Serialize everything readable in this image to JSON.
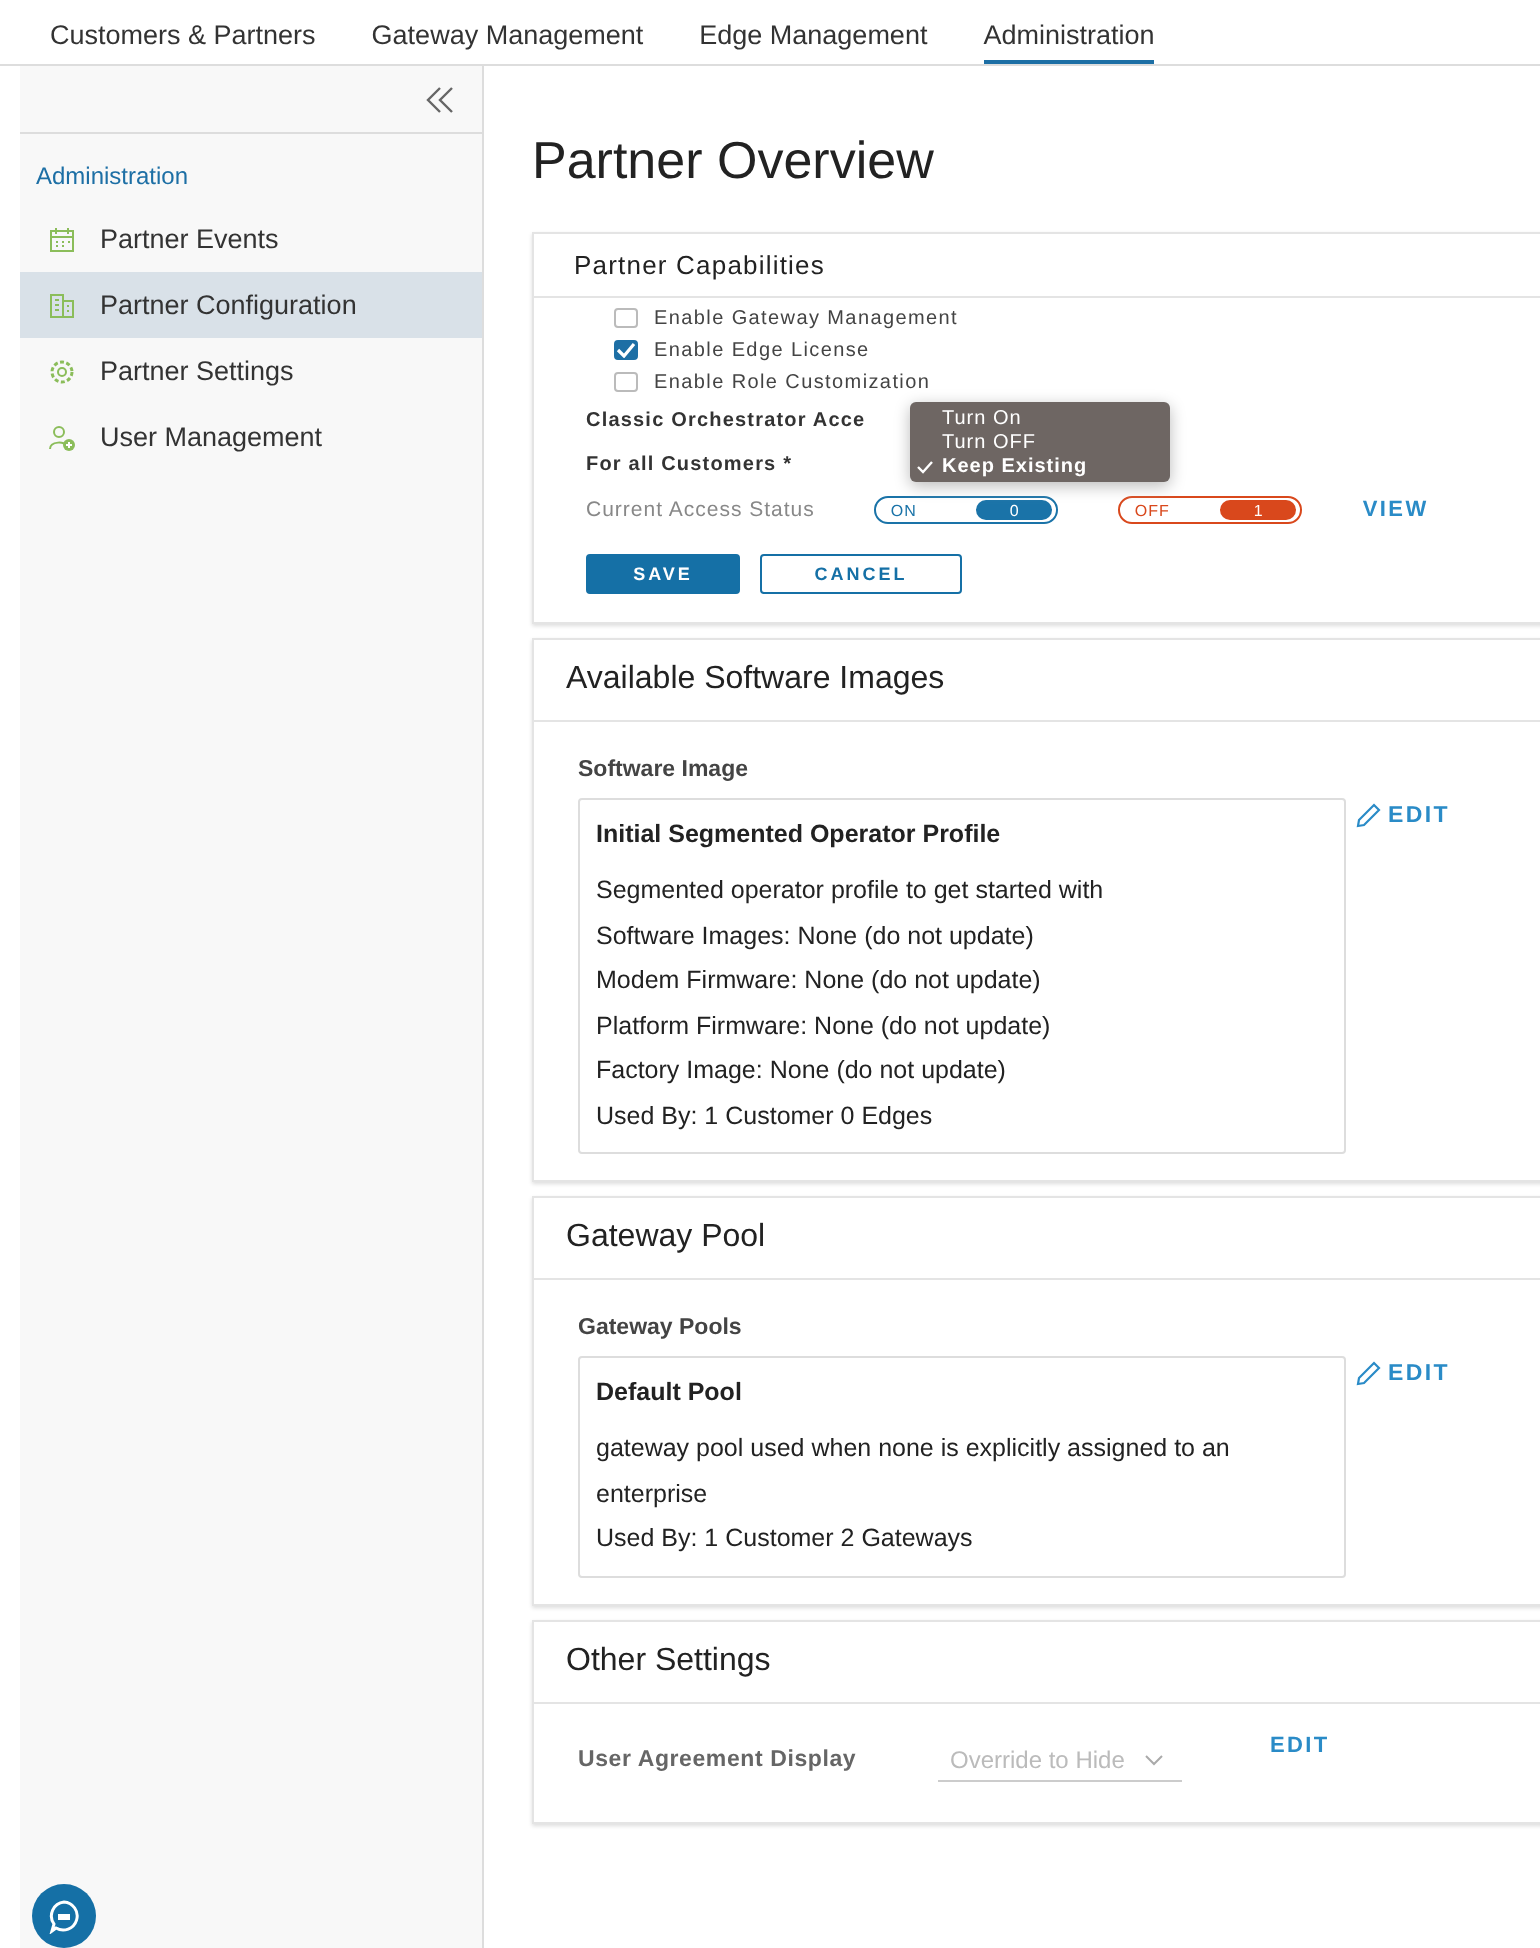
{
  "top_tabs": [
    {
      "label": "Customers & Partners",
      "selected": false
    },
    {
      "label": "Gateway Management",
      "selected": false
    },
    {
      "label": "Edge Management",
      "selected": false
    },
    {
      "label": "Administration",
      "selected": true
    }
  ],
  "sidebar": {
    "section": "Administration",
    "items": [
      {
        "label": "Partner Events",
        "selected": false
      },
      {
        "label": "Partner Configuration",
        "selected": true
      },
      {
        "label": "Partner Settings",
        "selected": false
      },
      {
        "label": "User Management",
        "selected": false
      }
    ]
  },
  "page_title": "Partner Overview",
  "capabilities": {
    "title": "Partner Capabilities",
    "options": [
      {
        "label": "Enable Gateway Management",
        "checked": false
      },
      {
        "label": "Enable Edge License",
        "checked": true
      },
      {
        "label": "Enable Role Customization",
        "checked": false
      }
    ],
    "classic_label": "Classic Orchestrator Acce",
    "customers_label": "For all Customers *",
    "menu": [
      {
        "label": "Turn On",
        "selected": false
      },
      {
        "label": "Turn OFF",
        "selected": false
      },
      {
        "label": "Keep Existing",
        "selected": true
      }
    ],
    "status_label": "Current Access Status",
    "status_pills": [
      {
        "label": "ON",
        "count": "0",
        "color": "#1a73a8"
      },
      {
        "label": "OFF",
        "count": "1",
        "color": "#d9481c"
      }
    ],
    "view": "VIEW",
    "buttons": [
      {
        "label": "SAVE",
        "kind": "primary"
      },
      {
        "label": "CANCEL",
        "kind": "secondary"
      }
    ]
  },
  "software_images": {
    "title": "Available Software Images",
    "label": "Software Image",
    "edit": "EDIT",
    "entry": {
      "name": "Initial Segmented Operator Profile",
      "lines": [
        "Segmented operator profile to get started with",
        "Software Images: None (do not update)",
        "Modem Firmware: None (do not update)",
        "Platform Firmware: None (do not update)",
        "Factory Image: None (do not update)",
        "Used By: 1 Customer 0 Edges"
      ]
    }
  },
  "gateway_pool": {
    "title": "Gateway Pool",
    "label": "Gateway Pools",
    "edit": "EDIT",
    "entry": {
      "name": "Default Pool",
      "lines": [
        "gateway pool used when none is explicitly assigned to an enterprise",
        "Used By: 1 Customer 2 Gateways"
      ]
    }
  },
  "other_settings": {
    "title": "Other Settings",
    "label": "User Agreement Display",
    "select_value": "Override to Hide",
    "edit": "EDIT"
  }
}
